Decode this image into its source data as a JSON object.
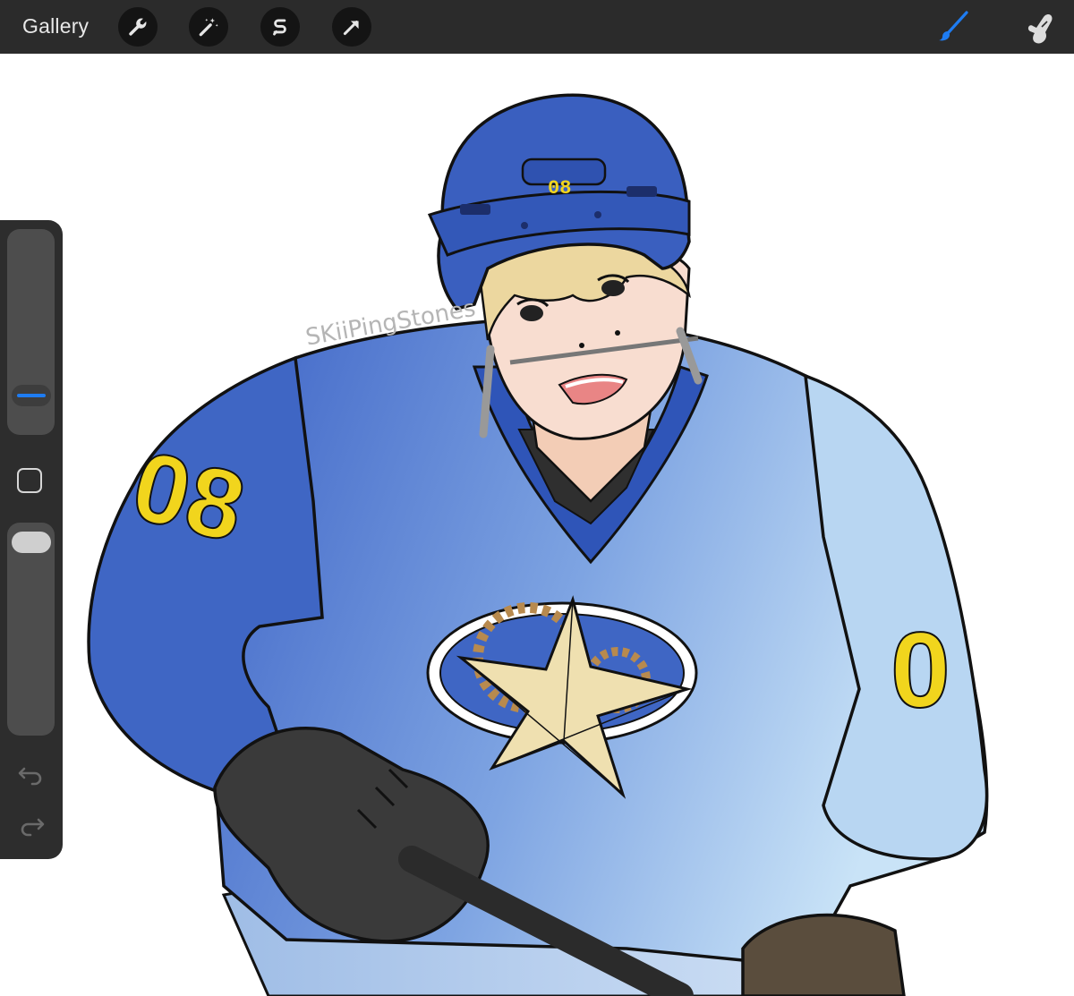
{
  "toolbar": {
    "gallery_label": "Gallery",
    "tools": [
      {
        "name": "actions",
        "icon": "wrench-icon"
      },
      {
        "name": "adjustments",
        "icon": "magic-wand-icon"
      },
      {
        "name": "selection",
        "icon": "selection-s-icon"
      },
      {
        "name": "transform",
        "icon": "transform-arrow-icon"
      }
    ],
    "right_tools": [
      {
        "name": "brush",
        "icon": "brush-icon",
        "active": true
      },
      {
        "name": "smudge",
        "icon": "smudge-icon",
        "active": false
      }
    ],
    "colors": {
      "bar": "#2b2b2b",
      "active_tool": "#1e7cf2",
      "icon": "#e6e6e6"
    }
  },
  "sidebar": {
    "brush_size_icon": "size-slider",
    "modify_button_icon": "square-icon",
    "opacity_icon": "opacity-slider",
    "undo_icon": "undo-icon",
    "redo_icon": "redo-icon"
  },
  "artwork": {
    "watermark": "SKiiPingStones",
    "helmet_number": "08",
    "sleeve_number_left": "08",
    "sleeve_number_right": "0",
    "colors": {
      "jersey_dark": "#3f66c4",
      "jersey_light": "#a9c8ef",
      "helmet": "#3a5fbf",
      "number_yellow": "#f1d51d",
      "glove": "#3a3a3a",
      "hair": "#e9d49a",
      "skin": "#f5d9c5"
    }
  }
}
